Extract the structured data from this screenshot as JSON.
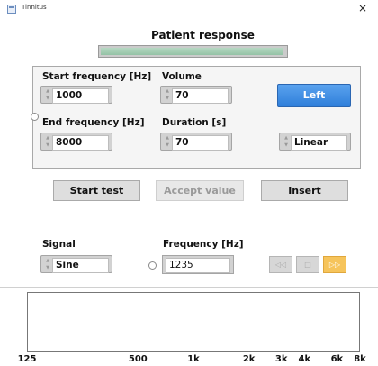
{
  "window": {
    "title": "Tinnitus",
    "close_glyph": "×"
  },
  "patient_response": {
    "label": "Patient response",
    "level": 0.97
  },
  "settings": {
    "start_frequency": {
      "label": "Start frequency [Hz]",
      "value": "1000"
    },
    "end_frequency": {
      "label": "End frequency [Hz]",
      "value": "8000"
    },
    "volume": {
      "label": "Volume",
      "value": "70"
    },
    "duration": {
      "label": "Duration [s]",
      "value": "70"
    },
    "ear_button": "Left",
    "sweep_mode": "Linear"
  },
  "actions": {
    "start": "Start test",
    "accept": "Accept value",
    "insert": "Insert"
  },
  "signal": {
    "label": "Signal",
    "value": "Sine"
  },
  "frequency": {
    "label": "Frequency [Hz]",
    "value": "1235"
  },
  "media": {
    "rewind_glyph": "◁◁",
    "stop_glyph": "□",
    "forward_glyph": "▷▷"
  },
  "plot": {
    "ticks": [
      {
        "label": "125",
        "value": 125
      },
      {
        "label": "500",
        "value": 500
      },
      {
        "label": "1k",
        "value": 1000
      },
      {
        "label": "2k",
        "value": 2000
      },
      {
        "label": "3k",
        "value": 3000
      },
      {
        "label": "4k",
        "value": 4000
      },
      {
        "label": "6k",
        "value": 6000
      },
      {
        "label": "8k",
        "value": 8000
      }
    ],
    "marker_value": 1235,
    "range": [
      125,
      8000
    ],
    "scale": "log"
  }
}
